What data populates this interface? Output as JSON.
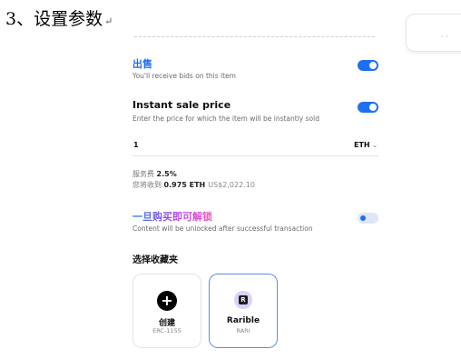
{
  "page": {
    "heading": "3、设置参数",
    "return_mark": "↵"
  },
  "settings": {
    "put_on_sale": {
      "title": "出售",
      "description": "You'll receive bids on this item",
      "enabled": true
    },
    "instant_sale": {
      "title": "Instant sale price",
      "description": "Enter the price for which the item will be instantly sold",
      "enabled": true
    },
    "price": {
      "value": "1",
      "currency": "ETH"
    },
    "fees": {
      "service_fee_label": "服务费",
      "service_fee_value": "2.5%",
      "receive_label": "您将收到",
      "receive_value": "0.975 ETH",
      "receive_usd": "US$2,022.10"
    },
    "unlock": {
      "title": "一旦购买即可解锁",
      "description": "Content will be unlocked after successful transaction",
      "enabled": false
    }
  },
  "collection": {
    "label": "选择收藏夹",
    "options": [
      {
        "name": "创建",
        "standard": "ERC-1155",
        "icon": "plus-icon"
      },
      {
        "name": "Rarible",
        "standard": "RARI",
        "icon": "rarible-logo-icon",
        "selected": true
      }
    ]
  },
  "colors": {
    "accent": "#1f6ff2",
    "toggle_off": "#dfe6f6",
    "selected_border": "#5d8fe6"
  }
}
